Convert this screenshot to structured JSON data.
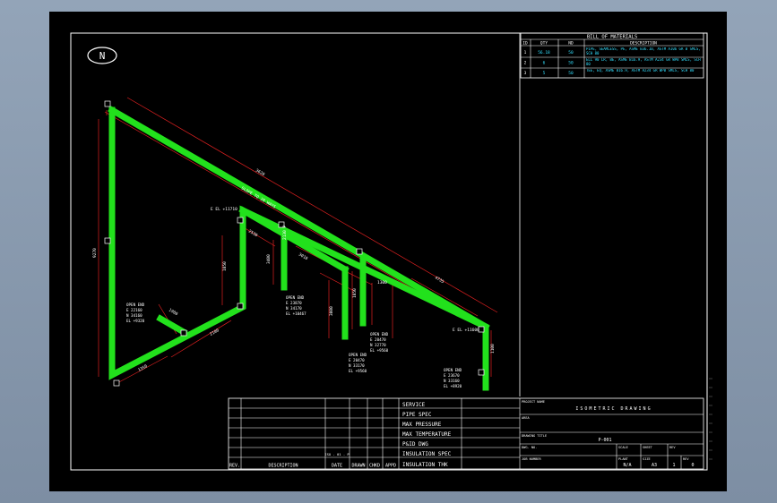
{
  "compass": {
    "label": "N"
  },
  "bom": {
    "title": "BILL OF MATERIALS",
    "headers": [
      "ID",
      "QTY",
      "ND",
      "DESCRIPTION"
    ],
    "rows": [
      [
        "1",
        "56.18",
        "50",
        "PIPE, SEAMLESS, PE, ASME B36.10, ASTM A106 GR B SMLS, SCH 80"
      ],
      [
        "2",
        "6",
        "50",
        "ELL 90 LR, BE, ASME B16.9, ASTM A234 GR WPB SMLS, SCH 80"
      ],
      [
        "3",
        "5",
        "50",
        "TEE, EQ, ASME B16.9, ASTM A234 GR WPB SMLS, SCH 80"
      ]
    ]
  },
  "iso_labels": {
    "top_dim_1": "3620",
    "top_dim_2": "4735",
    "left_vert": "9270",
    "seg_a": "1350",
    "seg_b": "2100",
    "seg_c": "1900",
    "seg_d": "1050",
    "seg_e": "2530",
    "seg_f": "3400",
    "seg_g": "3010",
    "seg_h": "3000",
    "seg_i": "1300",
    "seg_j": "1100",
    "seg_k": "1050",
    "dim_label_1": "2130 P",
    "slope": "SLOPE TO 20 WAYS",
    "el_1": "E EL +11710",
    "el_2": "E EL +11600",
    "node_labels": [
      "3",
      "1",
      "2",
      "2",
      "2",
      "1",
      "2",
      "2",
      "3",
      "1"
    ]
  },
  "open_ends": [
    {
      "lines": [
        "OPEN END",
        "E 22160",
        "N 34160",
        "EL +9320"
      ]
    },
    {
      "lines": [
        "OPEN END",
        "E 23870",
        "N 34170",
        "EL +10467"
      ]
    },
    {
      "lines": [
        "OPEN END",
        "E 20470",
        "N 33170",
        "EL +9560"
      ]
    },
    {
      "lines": [
        "OPEN END",
        "E 20470",
        "N 32770",
        "EL +9560"
      ]
    },
    {
      "lines": [
        "OPEN END",
        "E 23670",
        "N 33160",
        "EL +8920"
      ]
    }
  ],
  "title_block": {
    "fields": [
      "SERVICE",
      "PIPE SPEC",
      "MAX PRESSURE",
      "MAX TEMPERATURE",
      "P&ID DWG",
      "INSULATION SPEC",
      "INSULATION THK"
    ],
    "revision_headers": [
      "REV.",
      "DESCRIPTION",
      "DATE",
      "DRAWN",
      "CHKD",
      "APPD"
    ],
    "small_mark": "ISO - 01 - P",
    "project_name_label": "PROJECT NAME",
    "project_name_value": "ISOMETRIC DRAWING",
    "area_label": "AREA",
    "drawing_title_label": "DRAWING TITLE",
    "drawing_title_value": "P-001",
    "dwg_no_label": "DWG. NO.",
    "scale_label": "SCALE",
    "sheet_label": "SHEET",
    "rev_label": "REV",
    "job_label": "JOB NUMBER",
    "plant_label": "PLANT",
    "plant_value": "N/A",
    "sheet_value": "1",
    "sheet_total": "1",
    "rev_value": "0",
    "size_label": "SIZE",
    "size_value": "A3"
  },
  "colors": {
    "pipe": "#22e11c",
    "dimension": "#e02020",
    "border": "#ffffff",
    "text_cyan": "#33e0ff",
    "background": "#000000",
    "outer": "#8a9bb0"
  }
}
